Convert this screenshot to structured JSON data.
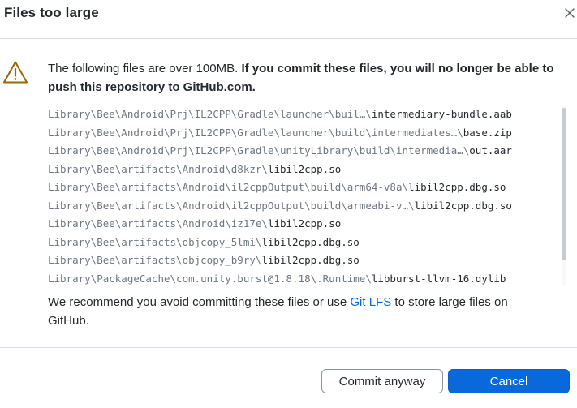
{
  "dialog": {
    "title": "Files too large",
    "close_icon": "close-icon",
    "warning_icon": "alert-triangle-icon",
    "intro_normal": "The following files are over 100MB. ",
    "intro_bold": "If you commit these files, you will no longer be able to push this repository to GitHub.com.",
    "files": [
      {
        "dir": "Library\\Bee\\Android\\Prj\\IL2CPP\\Gradle\\launcher\\buil…\\",
        "name": "intermediary-bundle.aab"
      },
      {
        "dir": "Library\\Bee\\Android\\Prj\\IL2CPP\\Gradle\\launcher\\build\\intermediates…\\",
        "name": "base.zip"
      },
      {
        "dir": "Library\\Bee\\Android\\Prj\\IL2CPP\\Gradle\\unityLibrary\\build\\intermedia…\\",
        "name": "out.aar"
      },
      {
        "dir": "Library\\Bee\\artifacts\\Android\\d8kzr\\",
        "name": "libil2cpp.so"
      },
      {
        "dir": "Library\\Bee\\artifacts\\Android\\il2cppOutput\\build\\arm64-v8a\\",
        "name": "libil2cpp.dbg.so"
      },
      {
        "dir": "Library\\Bee\\artifacts\\Android\\il2cppOutput\\build\\armeabi-v…\\",
        "name": "libil2cpp.dbg.so"
      },
      {
        "dir": "Library\\Bee\\artifacts\\Android\\iz17e\\",
        "name": "libil2cpp.so"
      },
      {
        "dir": "Library\\Bee\\artifacts\\objcopy_5lmi\\",
        "name": "libil2cpp.dbg.so"
      },
      {
        "dir": "Library\\Bee\\artifacts\\objcopy_b9ry\\",
        "name": "libil2cpp.dbg.so"
      },
      {
        "dir": "Library\\PackageCache\\com.unity.burst@1.8.18\\.Runtime\\",
        "name": "libburst-llvm-16.dylib"
      }
    ],
    "recommend_before": "We recommend you avoid committing these files or use ",
    "recommend_link": "Git LFS",
    "recommend_after": " to store large files on GitHub.",
    "buttons": {
      "commit_anyway": "Commit anyway",
      "cancel": "Cancel"
    },
    "colors": {
      "primary": "#0969da",
      "warning": "#9a6700",
      "link": "#0969da"
    }
  }
}
